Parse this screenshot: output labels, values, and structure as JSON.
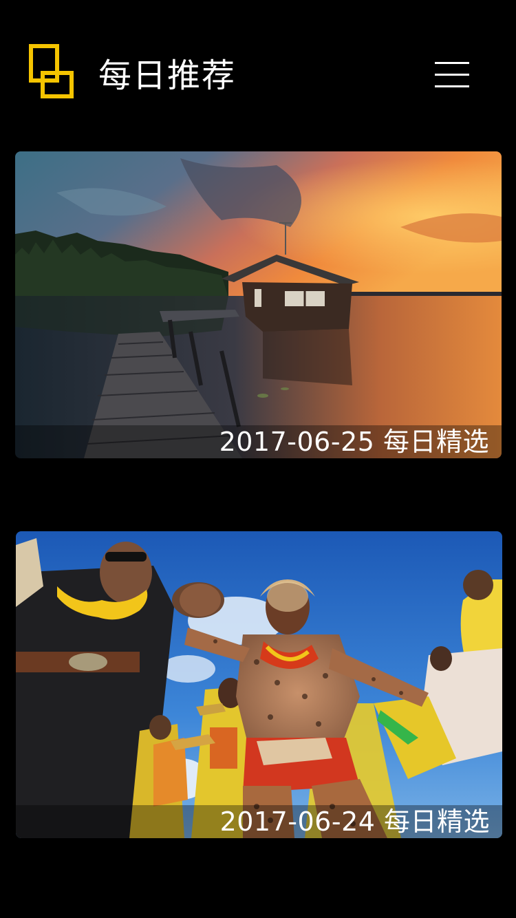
{
  "header": {
    "title": "每日推荐",
    "logo_icon": "overlapping-squares-logo-icon",
    "menu_icon": "hamburger-menu-icon",
    "accent_color": "#F5C400"
  },
  "cards": [
    {
      "caption": "2017-06-25 每日精选",
      "image": "lake-sunset-house-photo"
    },
    {
      "caption": "2017-06-24 每日精选",
      "image": "tiger-dance-festival-photo"
    }
  ]
}
